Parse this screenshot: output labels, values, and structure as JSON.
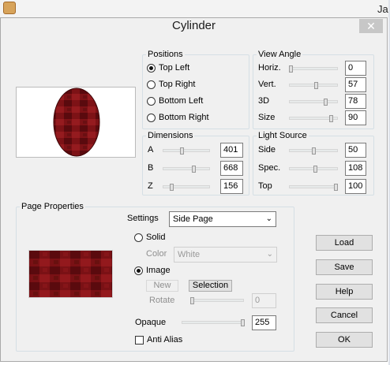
{
  "background_app": {
    "title_fragment": "Ja",
    "app_icon": "paint-shop-icon"
  },
  "dialog": {
    "title": "Cylinder",
    "close_glyph": "✕"
  },
  "positions": {
    "legend": "Positions",
    "options": [
      "Top Left",
      "Top Right",
      "Bottom Left",
      "Bottom Right"
    ],
    "selected": "Top Left"
  },
  "view_angle": {
    "legend": "View Angle",
    "rows": [
      {
        "label": "Horiz.",
        "value": "0",
        "level": 0.0
      },
      {
        "label": "Vert.",
        "value": "57",
        "level": 0.57
      },
      {
        "label": "3D",
        "value": "78",
        "level": 0.78
      },
      {
        "label": "Size",
        "value": "90",
        "level": 0.9
      }
    ]
  },
  "dimensions": {
    "legend": "Dimensions",
    "rows": [
      {
        "label": "A",
        "value": "401",
        "level": 0.4
      },
      {
        "label": "B",
        "value": "668",
        "level": 0.67
      },
      {
        "label": "Z",
        "value": "156",
        "level": 0.16
      }
    ]
  },
  "light_source": {
    "legend": "Light Source",
    "rows": [
      {
        "label": "Side",
        "value": "50",
        "level": 0.5
      },
      {
        "label": "Spec.",
        "value": "108",
        "level": 0.54
      },
      {
        "label": "Top",
        "value": "100",
        "level": 1.0
      }
    ]
  },
  "page_properties": {
    "legend": "Page Properties",
    "settings_label": "Settings",
    "settings_value": "Side Page",
    "solid_label": "Solid",
    "color_label": "Color",
    "color_value": "White",
    "image_label": "Image",
    "fill_mode": "Image",
    "new_label": "New",
    "selection_label": "Selection",
    "rotate_label": "Rotate",
    "rotate_value": "0",
    "opaque_label": "Opaque",
    "opaque_value": "255",
    "opaque_level": 1.0,
    "anti_alias_label": "Anti Alias",
    "anti_alias_checked": false
  },
  "buttons": {
    "load": "Load",
    "save": "Save",
    "help": "Help",
    "cancel": "Cancel",
    "ok": "OK"
  },
  "colors": {
    "texture_dark": "#5a0a0e",
    "texture_mid": "#8a1418",
    "dialog_bg": "#f0f0f0"
  }
}
